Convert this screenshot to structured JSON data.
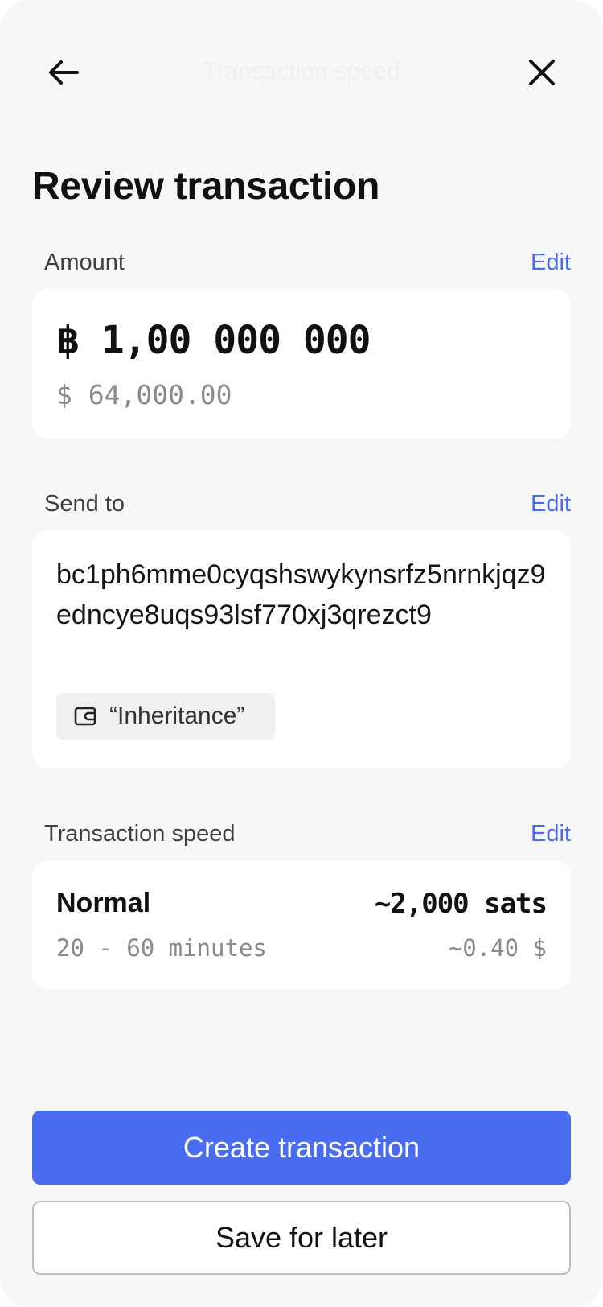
{
  "header": {
    "title": "Transaction speed",
    "back_icon": "arrow-left-icon",
    "close_icon": "close-icon"
  },
  "page": {
    "title": "Review transaction"
  },
  "amount": {
    "label": "Amount",
    "edit_label": "Edit",
    "btc_value": "฿ 1,00 000 000",
    "fiat_value": "$ 64,000.00"
  },
  "send_to": {
    "label": "Send to",
    "edit_label": "Edit",
    "address": "bc1ph6mme0cyqshswykynsrfz5nrnkjqz9edncye8uqs93lsf770xj3qrezct9",
    "wallet_icon": "wallet-icon",
    "wallet_label": "“Inheritance”"
  },
  "speed": {
    "label": "Transaction speed",
    "edit_label": "Edit",
    "name": "Normal",
    "fee": "~2,000 sats",
    "time": "20 - 60 minutes",
    "fee_fiat": "~0.40 $"
  },
  "actions": {
    "primary_label": "Create transaction",
    "secondary_label": "Save for later"
  },
  "colors": {
    "accent": "#4a6cf0",
    "background": "#f7f7f7",
    "card": "#ffffff"
  }
}
